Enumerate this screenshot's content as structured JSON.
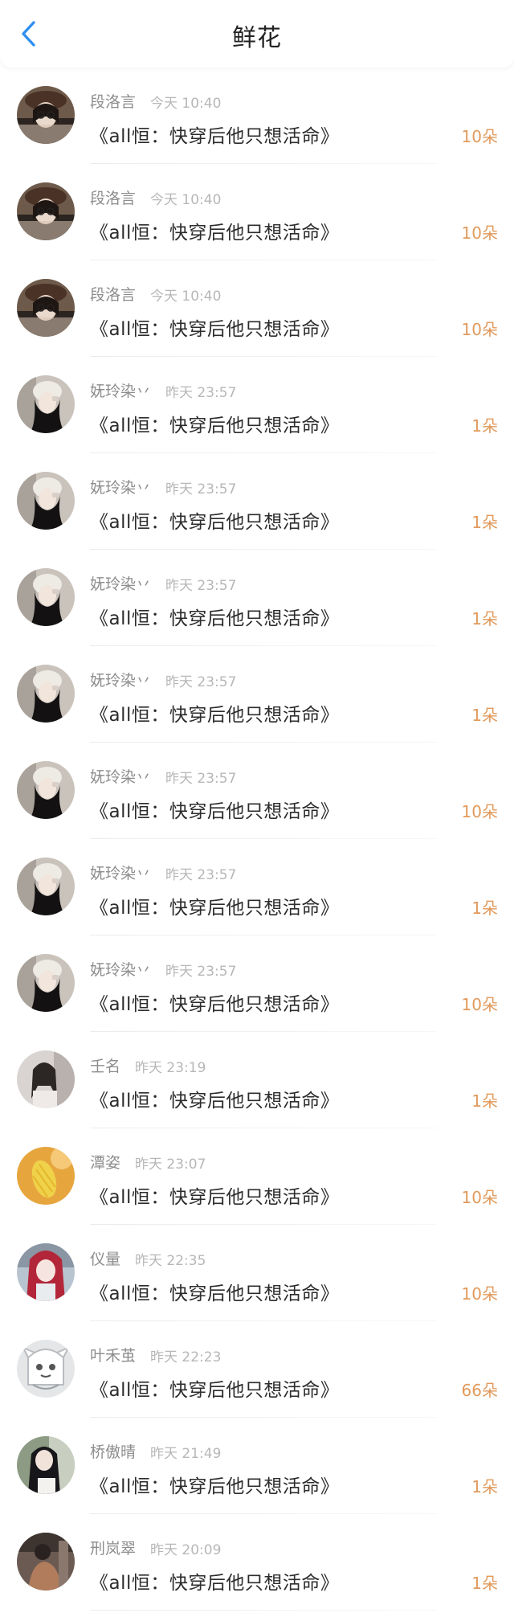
{
  "header": {
    "title": "鲜花",
    "back_icon": "chevron-left-icon"
  },
  "colors": {
    "accent": "#2f8ff0",
    "amount": "#e19a5c"
  },
  "items": [
    {
      "name": "段洛言",
      "time": "今天 10:40",
      "book": "《all恒：快穿后他只想活命》",
      "amount": "10朵",
      "avatar": "a"
    },
    {
      "name": "段洛言",
      "time": "今天 10:40",
      "book": "《all恒：快穿后他只想活命》",
      "amount": "10朵",
      "avatar": "a"
    },
    {
      "name": "段洛言",
      "time": "今天 10:40",
      "book": "《all恒：快穿后他只想活命》",
      "amount": "10朵",
      "avatar": "a"
    },
    {
      "name": "妩玲染丷",
      "time": "昨天 23:57",
      "book": "《all恒：快穿后他只想活命》",
      "amount": "1朵",
      "avatar": "b"
    },
    {
      "name": "妩玲染丷",
      "time": "昨天 23:57",
      "book": "《all恒：快穿后他只想活命》",
      "amount": "1朵",
      "avatar": "b"
    },
    {
      "name": "妩玲染丷",
      "time": "昨天 23:57",
      "book": "《all恒：快穿后他只想活命》",
      "amount": "1朵",
      "avatar": "b"
    },
    {
      "name": "妩玲染丷",
      "time": "昨天 23:57",
      "book": "《all恒：快穿后他只想活命》",
      "amount": "1朵",
      "avatar": "b"
    },
    {
      "name": "妩玲染丷",
      "time": "昨天 23:57",
      "book": "《all恒：快穿后他只想活命》",
      "amount": "10朵",
      "avatar": "b"
    },
    {
      "name": "妩玲染丷",
      "time": "昨天 23:57",
      "book": "《all恒：快穿后他只想活命》",
      "amount": "1朵",
      "avatar": "b"
    },
    {
      "name": "妩玲染丷",
      "time": "昨天 23:57",
      "book": "《all恒：快穿后他只想活命》",
      "amount": "10朵",
      "avatar": "b"
    },
    {
      "name": "壬名",
      "time": "昨天 23:19",
      "book": "《all恒：快穿后他只想活命》",
      "amount": "1朵",
      "avatar": "c"
    },
    {
      "name": "潭姿",
      "time": "昨天 23:07",
      "book": "《all恒：快穿后他只想活命》",
      "amount": "10朵",
      "avatar": "d"
    },
    {
      "name": "仪量",
      "time": "昨天 22:35",
      "book": "《all恒：快穿后他只想活命》",
      "amount": "10朵",
      "avatar": "e"
    },
    {
      "name": "叶禾茧",
      "time": "昨天 22:23",
      "book": "《all恒：快穿后他只想活命》",
      "amount": "66朵",
      "avatar": "f"
    },
    {
      "name": "桥傲晴",
      "time": "昨天 21:49",
      "book": "《all恒：快穿后他只想活命》",
      "amount": "1朵",
      "avatar": "g"
    },
    {
      "name": "刑岚翠",
      "time": "昨天 20:09",
      "book": "《all恒：快穿后他只想活命》",
      "amount": "1朵",
      "avatar": "h"
    }
  ]
}
